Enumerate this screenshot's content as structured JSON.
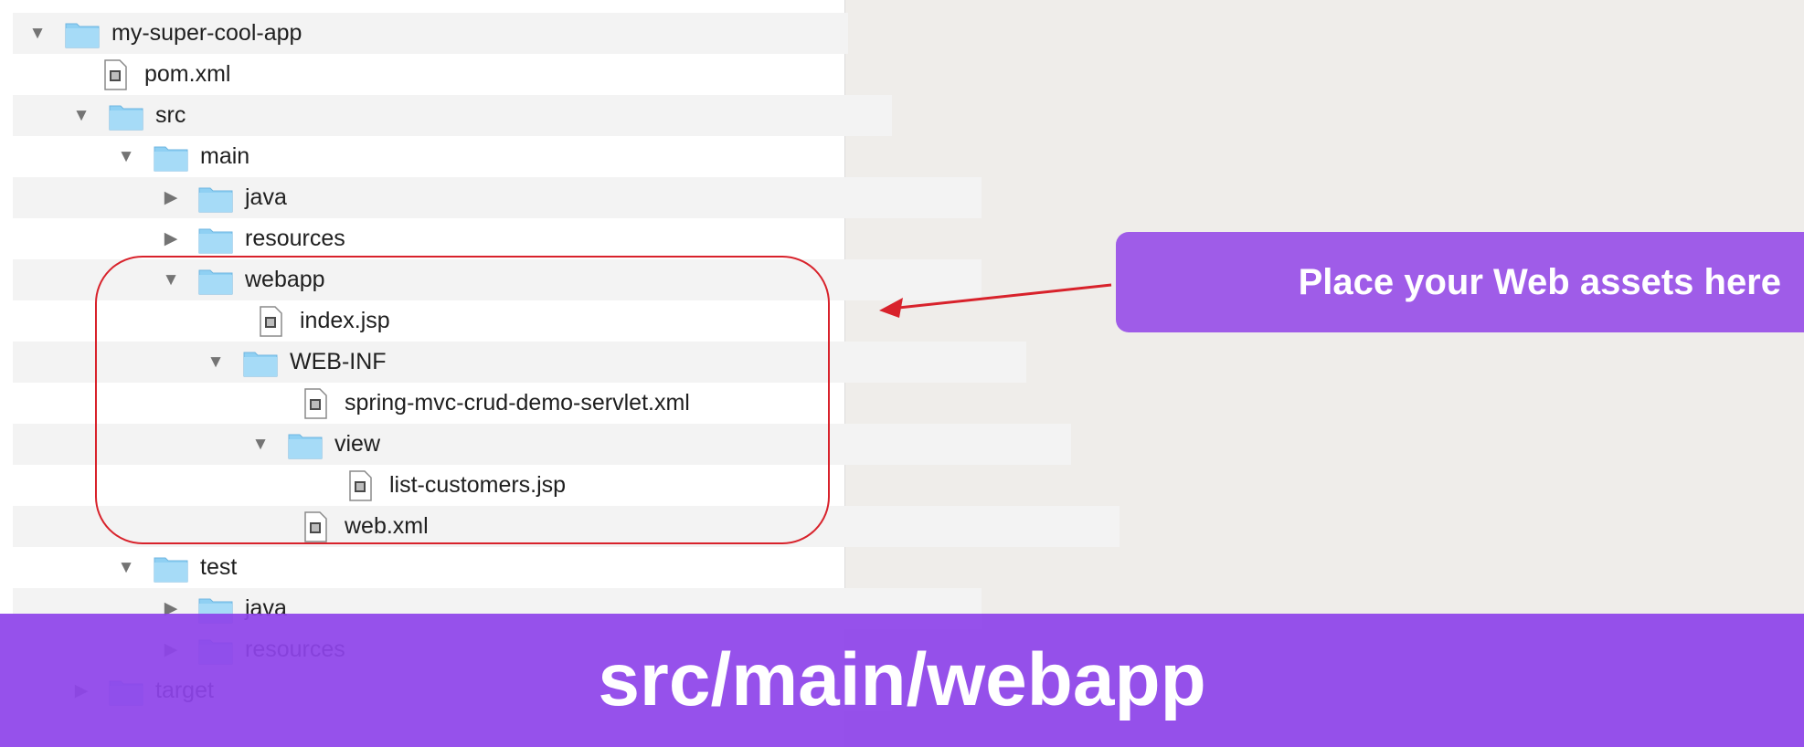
{
  "tree": {
    "items": [
      {
        "label": "my-super-cool-app",
        "kind": "folder",
        "state": "expanded",
        "icon": "folder-icon"
      },
      {
        "label": "pom.xml",
        "kind": "file",
        "state": "none",
        "icon": "file-icon"
      },
      {
        "label": "src",
        "kind": "folder",
        "state": "expanded",
        "icon": "folder-icon"
      },
      {
        "label": "main",
        "kind": "folder",
        "state": "expanded",
        "icon": "folder-icon"
      },
      {
        "label": "java",
        "kind": "folder",
        "state": "collapsed",
        "icon": "folder-icon"
      },
      {
        "label": "resources",
        "kind": "folder",
        "state": "collapsed",
        "icon": "folder-icon"
      },
      {
        "label": "webapp",
        "kind": "folder",
        "state": "expanded",
        "icon": "folder-icon"
      },
      {
        "label": "index.jsp",
        "kind": "file",
        "state": "none",
        "icon": "file-icon"
      },
      {
        "label": "WEB-INF",
        "kind": "folder",
        "state": "expanded",
        "icon": "folder-icon"
      },
      {
        "label": "spring-mvc-crud-demo-servlet.xml",
        "kind": "file",
        "state": "none",
        "icon": "file-icon"
      },
      {
        "label": "view",
        "kind": "folder",
        "state": "expanded",
        "icon": "folder-icon"
      },
      {
        "label": "list-customers.jsp",
        "kind": "file",
        "state": "none",
        "icon": "file-icon"
      },
      {
        "label": "web.xml",
        "kind": "file",
        "state": "none",
        "icon": "file-icon"
      },
      {
        "label": "test",
        "kind": "folder",
        "state": "expanded",
        "icon": "folder-icon"
      },
      {
        "label": "java",
        "kind": "folder",
        "state": "collapsed",
        "icon": "folder-icon"
      },
      {
        "label": "resources",
        "kind": "folder",
        "state": "collapsed",
        "icon": "folder-icon"
      },
      {
        "label": "target",
        "kind": "folder",
        "state": "collapsed",
        "icon": "folder-icon"
      }
    ]
  },
  "callout": {
    "text": "Place your Web assets here"
  },
  "banner": {
    "text": "src/main/webapp"
  },
  "colors": {
    "accent": "#9f5ce8",
    "banner": "#8e44ea",
    "highlight": "#d8222b",
    "folder": "#8fd0f3"
  }
}
